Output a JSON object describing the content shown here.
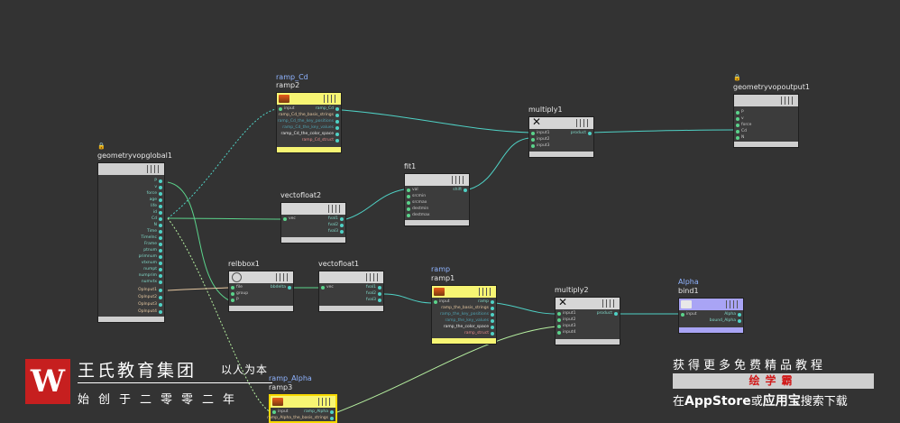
{
  "colors": {
    "background": "#333333",
    "wire_green": "#5bd38b",
    "wire_cyan": "#4fd1c5",
    "wire_pale": "#b6f0a0",
    "wire_tan": "#e5c7a0",
    "node_yellow": "#f7f573",
    "node_blue": "#a9a4f5",
    "logo_red": "#c61f1f"
  },
  "nodes": {
    "geometryvopglobal1": {
      "name": "geometryvopglobal1",
      "outputs": [
        "P",
        "v",
        "force",
        "age",
        "life",
        "id",
        "Cd",
        "N",
        "Time",
        "TimeInc",
        "Frame",
        "ptnum",
        "primnum",
        "vtxnum",
        "numpt",
        "numprim",
        "numvtx",
        "OpInput1",
        "OpInput2",
        "OpInput3",
        "OpInput4"
      ]
    },
    "ramp_cd": {
      "name": "ramp2",
      "sub": "ramp_Cd",
      "inputs": [
        "input"
      ],
      "outputs": [
        "ramp_Cd",
        "ramp_Cd_the_basis_strings",
        "ramp_Cd_the_key_positions",
        "ramp_Cd_the_key_values",
        "ramp_Cd_the_color_space",
        "ramp_Cd_struct"
      ]
    },
    "vectofloat2": {
      "name": "vectofloat2",
      "inputs": [
        "vec"
      ],
      "outputs": [
        "fval1",
        "fval2",
        "fval3"
      ]
    },
    "fit1": {
      "name": "fit1",
      "inputs": [
        "val",
        "srcmin",
        "srcmax",
        "destmin",
        "destmax"
      ],
      "outputs": [
        "shift"
      ]
    },
    "multiply1": {
      "name": "multiply1",
      "inputs": [
        "input1",
        "input2",
        "input3"
      ],
      "outputs": [
        "product"
      ]
    },
    "geometryvopoutput1": {
      "name": "geometryvopoutput1",
      "inputs": [
        "P",
        "v",
        "force",
        "Cd",
        "N"
      ]
    },
    "relbbox1": {
      "name": "relbbox1",
      "inputs": [
        "file",
        "group",
        "P"
      ],
      "outputs": [
        "bbdelta"
      ]
    },
    "vectofloat1": {
      "name": "vectofloat1",
      "inputs": [
        "vec"
      ],
      "outputs": [
        "fval1",
        "fval2",
        "fval3"
      ]
    },
    "ramp1": {
      "name": "ramp1",
      "sub": "ramp",
      "inputs": [
        "input"
      ],
      "outputs": [
        "ramp",
        "ramp_the_basis_strings",
        "ramp_the_key_positions",
        "ramp_the_key_values",
        "ramp_the_color_space",
        "ramp_struct"
      ]
    },
    "multiply2": {
      "name": "multiply2",
      "inputs": [
        "input1",
        "input2",
        "input3",
        "input4"
      ],
      "outputs": [
        "product"
      ]
    },
    "bind1": {
      "name": "bind1",
      "sub": "Alpha",
      "inputs": [
        "input"
      ],
      "outputs": [
        "Alpha",
        "bound_Alpha"
      ]
    },
    "ramp3": {
      "name": "ramp3",
      "sub": "ramp_Alpha",
      "inputs": [
        "input"
      ],
      "outputs": [
        "ramp_Alpha",
        "ramp_Alpha_the_basis_strings"
      ]
    }
  },
  "watermark": {
    "logo_letter": "W",
    "title": "王氏教育集团",
    "motto": "以人为本",
    "subtitle": "始创于二零零二年"
  },
  "ad": {
    "line1": "获得更多免费精品教程",
    "banner": "绘学霸",
    "line2_prefix": "在",
    "appstore": "AppStore",
    "line2_or": "或",
    "yingyongbao": "应用宝",
    "line2_suffix": "搜索下载"
  }
}
